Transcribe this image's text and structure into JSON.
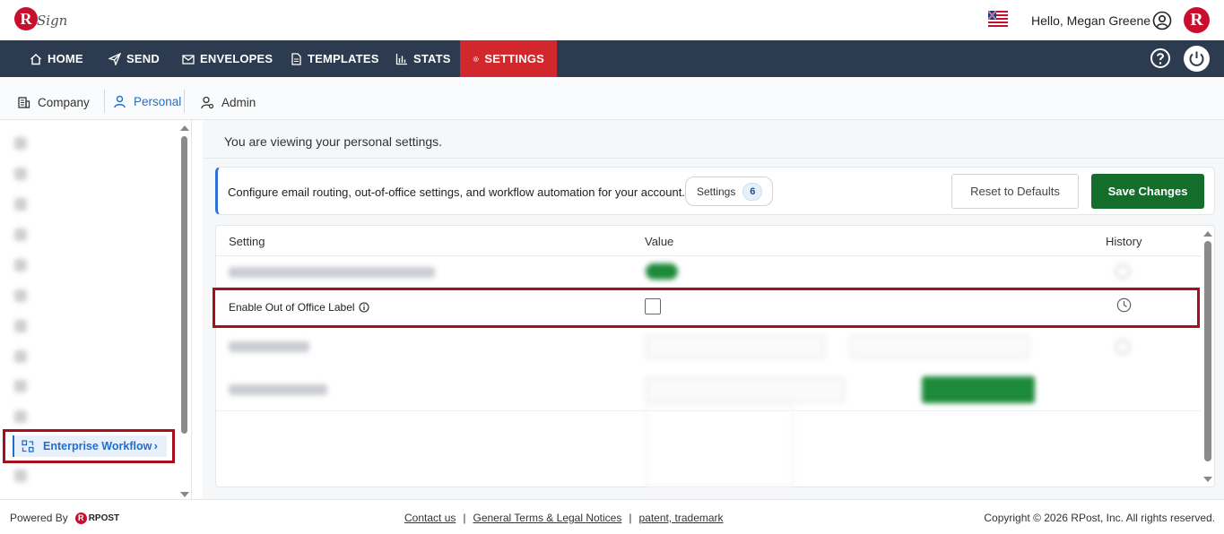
{
  "app": {
    "logo_letter": "R",
    "logo_word": "Sign"
  },
  "header": {
    "greeting": "Hello, Megan Greene",
    "brand_badge": "R"
  },
  "nav": {
    "items": [
      {
        "label": "HOME",
        "icon": "home-icon"
      },
      {
        "label": "SEND",
        "icon": "send-icon"
      },
      {
        "label": "ENVELOPES",
        "icon": "envelope-icon"
      },
      {
        "label": "TEMPLATES",
        "icon": "document-icon"
      },
      {
        "label": "STATS",
        "icon": "bar-chart-icon"
      },
      {
        "label": "SETTINGS",
        "icon": "gear-icon",
        "active": true
      }
    ],
    "active_color": "#d3272e",
    "bar_color": "#2c3b4f"
  },
  "subtabs": [
    {
      "label": "Company",
      "icon": "building-icon"
    },
    {
      "label": "Personal",
      "icon": "person-icon",
      "active": true
    },
    {
      "label": "Admin",
      "icon": "admin-user-icon"
    }
  ],
  "sidebar": {
    "active_item": {
      "label": "Enterprise Workflow",
      "icon": "workflow-icon"
    }
  },
  "main": {
    "viewing_text": "You are viewing your personal settings.",
    "info_text": "Configure email routing, out-of-office settings, and workflow automation for your account.",
    "settings_pill": {
      "label": "Settings",
      "count": "6"
    },
    "reset_button": "Reset to Defaults",
    "save_button": "Save Changes",
    "table": {
      "headers": {
        "setting": "Setting",
        "value": "Value",
        "history": "History"
      },
      "highlighted_row": {
        "label": "Enable Out of Office Label",
        "checked": false
      }
    }
  },
  "footer": {
    "powered_by": "Powered By",
    "rpost": "RPOST",
    "links": [
      "Contact us",
      "General Terms & Legal Notices",
      "patent, trademark"
    ],
    "separator": "|",
    "copyright": "Copyright © 2026 RPost, Inc. All rights reserved."
  }
}
